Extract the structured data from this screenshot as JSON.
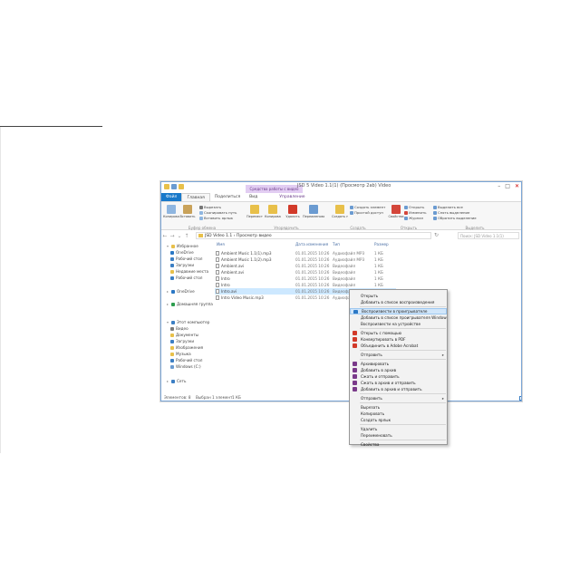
{
  "window": {
    "title": "JSD 5 Video 1.1(1) (Просмотр 2ab) Video",
    "context_tab_title": "Средства работы с видео",
    "controls": [
      "–",
      "□",
      "✕"
    ]
  },
  "ribbon_tabs": [
    {
      "label": "Файл",
      "kind": "file"
    },
    {
      "label": "Главная",
      "kind": "active"
    },
    {
      "label": "Поделиться",
      "kind": "normal"
    },
    {
      "label": "Вид",
      "kind": "normal"
    },
    {
      "label": "Управление",
      "kind": "manage"
    }
  ],
  "ribbon": {
    "clipboard": {
      "copy": "Копировать",
      "paste": "Вставить",
      "cut": "Вырезать",
      "copy_path": "Скопировать путь",
      "paste_shortcut": "Вставить ярлык",
      "label": "Буфер обмена"
    },
    "organize": {
      "move": "Переместить в",
      "copy_to": "Копировать в",
      "delete": "Удалить",
      "rename": "Переименовать",
      "label": "Упорядочить"
    },
    "new": {
      "new_folder": "Создать папку",
      "new_item": "Создать элемент",
      "easy_access": "Простой доступ",
      "label": "Создать"
    },
    "open": {
      "properties": "Свойства",
      "open": "Открыть",
      "edit": "Изменить",
      "history": "Журнал",
      "label": "Открыть"
    },
    "select": {
      "select_all": "Выделить все",
      "select_none": "Снять выделение",
      "invert": "Обратить выделение",
      "label": "Выделить"
    }
  },
  "address": {
    "path": "JSD Video 1.1 › Просмотр видео",
    "search_placeholder": "Поиск: JSD Video 1.1(1)"
  },
  "nav": {
    "favorites_header": "Избранное",
    "favorites": [
      "OneDrive",
      "Рабочий стол",
      "Загрузки",
      "Недавние места",
      "Рабочий стол"
    ],
    "onedrive": "OneDrive",
    "homegroup": "Домашняя группа",
    "pc_header": "Этот компьютер",
    "pc_items": [
      "Видео",
      "Документы",
      "Загрузки",
      "Изображения",
      "Музыка",
      "Рабочий стол",
      "Windows (C:)"
    ],
    "network": "Сеть"
  },
  "columns": {
    "name": "Имя",
    "date": "Дата изменения",
    "type": "Тип",
    "size": "Размер"
  },
  "files": [
    {
      "name": "Ambient Music 1.1(1).mp3",
      "date": "01.01.2015 10:26",
      "type": "Аудиофайл MP3",
      "size": "1 КБ",
      "selected": false
    },
    {
      "name": "Ambient Music 1.1(2).mp3",
      "date": "01.01.2015 10:26",
      "type": "Аудиофайл MP3",
      "size": "1 КБ",
      "selected": false
    },
    {
      "name": "Ambient.avi",
      "date": "01.01.2015 10:26",
      "type": "Видеофайл",
      "size": "1 КБ",
      "selected": false
    },
    {
      "name": "Ambient.avi",
      "date": "01.01.2015 10:26",
      "type": "Видеофайл",
      "size": "1 КБ",
      "selected": false
    },
    {
      "name": "Intro",
      "date": "01.01.2015 10:26",
      "type": "Видеофайл",
      "size": "1 КБ",
      "selected": false
    },
    {
      "name": "Intro",
      "date": "01.01.2015 10:26",
      "type": "Видеофайл",
      "size": "1 КБ",
      "selected": false
    },
    {
      "name": "Intro.avi",
      "date": "01.01.2015 10:26",
      "type": "Видеофайл",
      "size": "1 КБ",
      "selected": true
    },
    {
      "name": "Intro Video Music.mp3",
      "date": "01.01.2015 10:26",
      "type": "Аудиофайл MP3",
      "size": "1 КБ",
      "selected": false
    }
  ],
  "status": {
    "count": "Элементов: 8",
    "selected": "Выбран 1 элемент",
    "size": "1 КБ"
  },
  "context_menu": {
    "items": [
      {
        "label": "Открыть",
        "type": "item",
        "icon": "",
        "color": ""
      },
      {
        "label": "Добавить в список воспроизведения",
        "type": "item",
        "icon": "",
        "color": ""
      },
      {
        "label": "Воспроизвести в проигрывателе",
        "type": "item",
        "icon": "play-icon",
        "color": "#2b78c5",
        "highlighted": true
      },
      {
        "label": "Добавить в список проигрывателя Windows",
        "type": "item",
        "icon": "",
        "color": ""
      },
      {
        "label": "Воспроизвести на устройстве",
        "type": "item",
        "icon": "",
        "color": ""
      },
      {
        "label": "Открыть с помощью",
        "type": "item",
        "icon": "pdf-icon",
        "color": "#d23a2a"
      },
      {
        "label": "Конвертировать в PDF",
        "type": "item",
        "icon": "pdf-icon",
        "color": "#d23a2a"
      },
      {
        "label": "Объединить в Adobe Acrobat",
        "type": "item",
        "icon": "pdf-icon",
        "color": "#d23a2a"
      },
      {
        "label": "Отправить",
        "type": "submenu",
        "icon": "",
        "color": ""
      },
      {
        "label": "Архивировать",
        "type": "item",
        "icon": "archive-icon",
        "color": "#7a3a8a"
      },
      {
        "label": "Добавить в архив",
        "type": "item",
        "icon": "archive-icon",
        "color": "#7a3a8a"
      },
      {
        "label": "Сжать и отправить",
        "type": "item",
        "icon": "archive-icon",
        "color": "#7a3a8a"
      },
      {
        "label": "Сжать в архив и отправить",
        "type": "item",
        "icon": "archive-icon",
        "color": "#7a3a8a"
      },
      {
        "label": "Добавить в архив и отправить",
        "type": "item",
        "icon": "archive-icon",
        "color": "#7a3a8a"
      },
      {
        "label": "Отправить",
        "type": "submenu",
        "icon": "",
        "color": ""
      },
      {
        "label": "Вырезать",
        "type": "item",
        "icon": "",
        "color": ""
      },
      {
        "label": "Копировать",
        "type": "item",
        "icon": "",
        "color": ""
      },
      {
        "label": "Создать ярлык",
        "type": "item",
        "icon": "",
        "color": ""
      },
      {
        "label": "Удалить",
        "type": "item",
        "icon": "",
        "color": ""
      },
      {
        "label": "Переименовать",
        "type": "item",
        "icon": "",
        "color": ""
      },
      {
        "label": "Свойства",
        "type": "item",
        "icon": "",
        "color": ""
      }
    ]
  },
  "colors": {
    "accent": "#1979ca",
    "manage_tab": "#e2cdf2",
    "selection": "#cde8ff",
    "menu_highlight": "#d1e6fa"
  }
}
